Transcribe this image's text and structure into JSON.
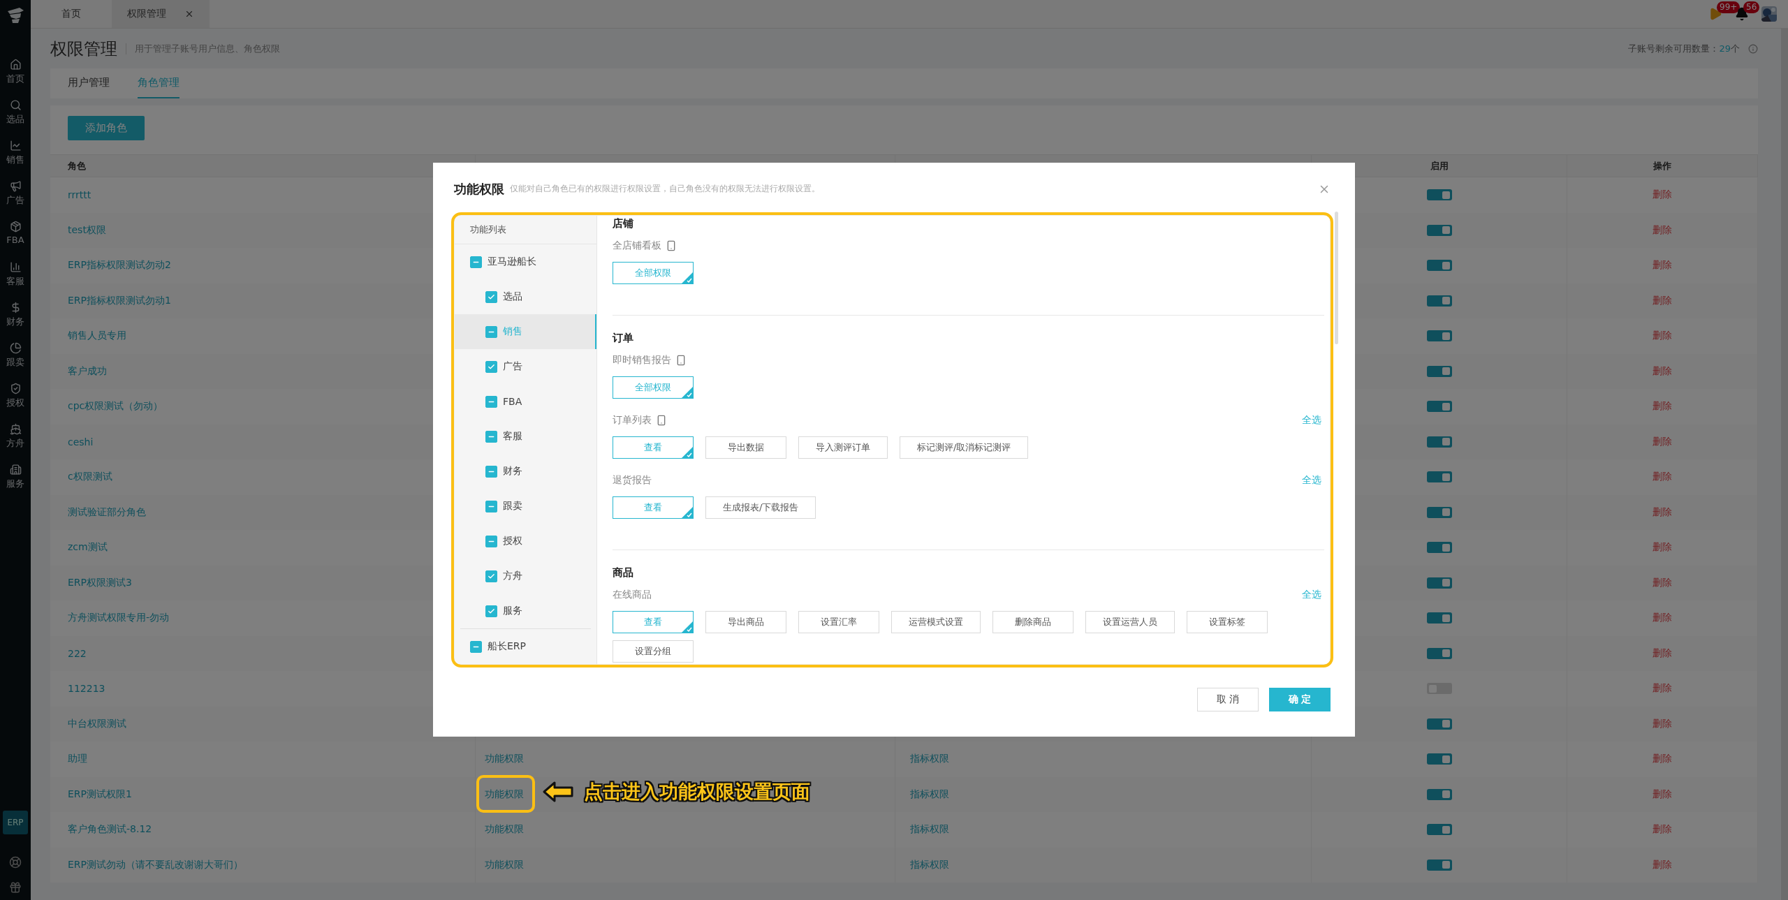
{
  "sidebar": {
    "items": [
      {
        "label": "首页"
      },
      {
        "label": "选品"
      },
      {
        "label": "销售"
      },
      {
        "label": "广告"
      },
      {
        "label": "FBA"
      },
      {
        "label": "客服"
      },
      {
        "label": "财务"
      },
      {
        "label": "跟卖"
      },
      {
        "label": "授权"
      },
      {
        "label": "方舟"
      },
      {
        "label": "服务"
      }
    ],
    "erp_badge": "ERP"
  },
  "tabs": [
    {
      "label": "首页",
      "selected": false,
      "closable": false
    },
    {
      "label": "权限管理",
      "selected": true,
      "closable": true
    }
  ],
  "notifications": [
    {
      "badge": "99+"
    },
    {
      "badge": "56"
    }
  ],
  "page": {
    "title": "权限管理",
    "subtitle": "用于管理子账号用户信息、角色权限",
    "quota_label": "子账号剩余可用数量：",
    "quota_value": "29",
    "quota_unit": "个"
  },
  "subtabs": [
    {
      "label": "用户管理",
      "selected": false
    },
    {
      "label": "角色管理",
      "selected": true
    }
  ],
  "add_button": "添加角色",
  "table": {
    "columns": {
      "role": "角色",
      "enabled": "启用",
      "action": "操作"
    },
    "rows": [
      {
        "role": "rrrttt",
        "enabled": true,
        "action": "删除"
      },
      {
        "role": "test权限",
        "enabled": true,
        "action": "删除"
      },
      {
        "role": "ERP指标权限测试勿动2",
        "enabled": true,
        "action": "删除"
      },
      {
        "role": "ERP指标权限测试勿动1",
        "enabled": true,
        "action": "删除"
      },
      {
        "role": "销售人员专用",
        "enabled": true,
        "action": "删除"
      },
      {
        "role": "客户成功",
        "enabled": true,
        "action": "删除"
      },
      {
        "role": "cpc权限测试（勿动）",
        "enabled": true,
        "action": "删除"
      },
      {
        "role": "ceshi",
        "enabled": true,
        "action": "删除"
      },
      {
        "role": "c权限测试",
        "enabled": true,
        "action": "删除"
      },
      {
        "role": "测试验证部分角色",
        "enabled": true,
        "action": "删除"
      },
      {
        "role": "zcm测试",
        "enabled": true,
        "action": "删除"
      },
      {
        "role": "ERP权限测试3",
        "enabled": true,
        "action": "删除"
      },
      {
        "role": "方舟测试权限专用-勿动",
        "enabled": true,
        "action": "删除"
      },
      {
        "role": "222",
        "enabled": true,
        "action": "删除"
      },
      {
        "role": "112213",
        "enabled": false,
        "action": "删除"
      },
      {
        "role": "中台权限测试",
        "enabled": true,
        "action": "删除"
      },
      {
        "role": "助理",
        "permission": "功能权限",
        "metric": "指标权限",
        "enabled": true,
        "action": "删除"
      },
      {
        "role": "ERP测试权限1",
        "permission": "功能权限",
        "metric": "指标权限",
        "enabled": true,
        "action": "删除",
        "highlighted": true
      },
      {
        "role": "客户角色测试-8.12",
        "permission": "功能权限",
        "metric": "指标权限",
        "enabled": true,
        "action": "删除"
      },
      {
        "role": "ERP测试勿动（请不要乱改谢谢大哥们）",
        "permission": "功能权限",
        "metric": "指标权限",
        "enabled": true,
        "action": "删除"
      }
    ]
  },
  "modal": {
    "title": "功能权限",
    "hint": "仅能对自己角色已有的权限进行权限设置，自己角色没有的权限无法进行权限设置。",
    "tree_title": "功能列表",
    "tree": [
      {
        "label": "亚马逊船长",
        "checked": true,
        "indeterminate": true,
        "selected": false,
        "children": [
          {
            "label": "选品",
            "checked": true,
            "indeterminate": false,
            "selected": false
          },
          {
            "label": "销售",
            "checked": true,
            "indeterminate": true,
            "selected": true
          },
          {
            "label": "广告",
            "checked": true,
            "indeterminate": false,
            "selected": false
          },
          {
            "label": "FBA",
            "checked": true,
            "indeterminate": true,
            "selected": false
          },
          {
            "label": "客服",
            "checked": true,
            "indeterminate": true,
            "selected": false
          },
          {
            "label": "财务",
            "checked": true,
            "indeterminate": true,
            "selected": false
          },
          {
            "label": "跟卖",
            "checked": true,
            "indeterminate": true,
            "selected": false
          },
          {
            "label": "授权",
            "checked": true,
            "indeterminate": true,
            "selected": false
          },
          {
            "label": "方舟",
            "checked": true,
            "indeterminate": false,
            "selected": false
          },
          {
            "label": "服务",
            "checked": true,
            "indeterminate": false,
            "selected": false
          }
        ]
      },
      {
        "label": "船长ERP",
        "checked": true,
        "indeterminate": true,
        "selected": false
      }
    ],
    "sections": [
      {
        "title": "店铺",
        "groups": [
          {
            "label": "全店铺看板",
            "mobile": true,
            "buttons": [
              {
                "label": "全部权限",
                "selected": true
              }
            ]
          }
        ]
      },
      {
        "title": "订单",
        "groups": [
          {
            "label": "即时销售报告",
            "mobile": true,
            "buttons": [
              {
                "label": "全部权限",
                "selected": true
              }
            ]
          },
          {
            "label": "订单列表",
            "mobile": true,
            "select_all": "全选",
            "buttons": [
              {
                "label": "查看",
                "selected": true
              },
              {
                "label": "导出数据",
                "selected": false
              },
              {
                "label": "导入测评订单",
                "selected": false
              },
              {
                "label": "标记测评/取消标记测评",
                "selected": false
              }
            ]
          },
          {
            "label": "退货报告",
            "mobile": false,
            "select_all": "全选",
            "buttons": [
              {
                "label": "查看",
                "selected": true
              },
              {
                "label": "生成报表/下载报告",
                "selected": false
              }
            ]
          }
        ]
      },
      {
        "title": "商品",
        "groups": [
          {
            "label": "在线商品",
            "mobile": false,
            "select_all": "全选",
            "buttons": [
              {
                "label": "查看",
                "selected": true
              },
              {
                "label": "导出商品",
                "selected": false
              },
              {
                "label": "设置汇率",
                "selected": false
              },
              {
                "label": "运营模式设置",
                "selected": false
              },
              {
                "label": "删除商品",
                "selected": false
              },
              {
                "label": "设置运营人员",
                "selected": false
              },
              {
                "label": "设置标签",
                "selected": false
              },
              {
                "label": "设置分组",
                "selected": false
              }
            ]
          }
        ]
      }
    ],
    "cancel": "取 消",
    "confirm": "确 定"
  },
  "annotation": {
    "text": "点击进入功能权限设置页面"
  }
}
